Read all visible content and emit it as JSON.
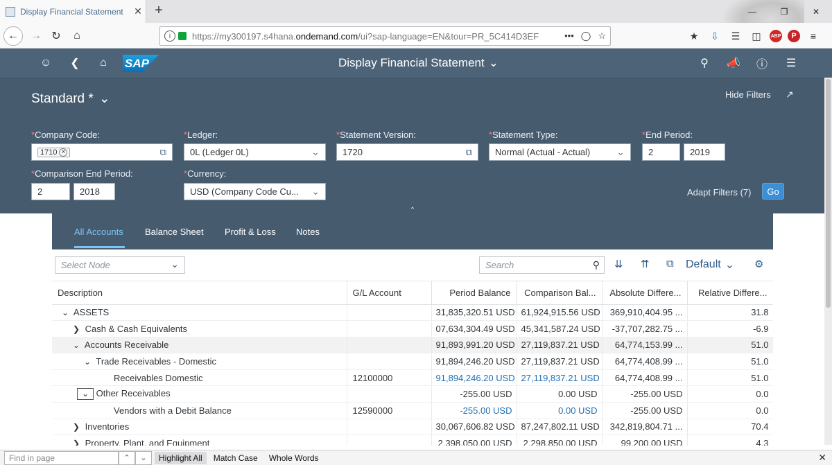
{
  "browser": {
    "tab_title": "Display Financial Statement",
    "tab_close": "✕",
    "new_tab": "+",
    "url_host": "my300197.s4hana.",
    "url_domain": "ondemand.com",
    "url_path": "/ui?sap-language=EN&tour=PR_5C414D3EF",
    "url_prefix": "https://",
    "url_more": "•••"
  },
  "shell": {
    "logo": "SAP",
    "title": "Display Financial Statement"
  },
  "filters": {
    "variant": "Standard *",
    "hide_filters": "Hide Filters",
    "adapt_filters": "Adapt Filters (7)",
    "go": "Go",
    "required_mark": "*",
    "company_code": {
      "label": "Company Code:",
      "token": "1710"
    },
    "ledger": {
      "label": "Ledger:",
      "value": "0L (Ledger 0L)"
    },
    "statement_version": {
      "label": "Statement Version:",
      "value": "1720"
    },
    "statement_type": {
      "label": "Statement Type:",
      "value": "Normal (Actual - Actual)"
    },
    "end_period": {
      "label": "End Period:",
      "period": "2",
      "year": "2019"
    },
    "comparison_end_period": {
      "label": "Comparison End Period:",
      "period": "2",
      "year": "2018"
    },
    "currency": {
      "label": "Currency:",
      "value": "USD (Company Code Cu..."
    }
  },
  "tabs": [
    "All Accounts",
    "Balance Sheet",
    "Profit & Loss",
    "Notes"
  ],
  "tools": {
    "select_node_placeholder": "Select Node",
    "search_placeholder": "Search",
    "layout": "Default"
  },
  "table": {
    "columns": [
      "Description",
      "G/L Account",
      "Period Balance",
      "Comparison Bal...",
      "Absolute Differe...",
      "Relative Differe..."
    ],
    "rows": [
      {
        "desc": "ASSETS",
        "gl": "",
        "period": "31,835,320.51 USD",
        "comparison": "61,924,915.56 USD",
        "absolute": "369,910,404.95 ...",
        "relative": "31.8"
      },
      {
        "desc": "Cash & Cash Equivalents",
        "gl": "",
        "period": "07,634,304.49 USD",
        "comparison": "45,341,587.24 USD",
        "absolute": "-37,707,282.75 ...",
        "relative": "-6.9"
      },
      {
        "desc": "Accounts Receivable",
        "gl": "",
        "period": "91,893,991.20 USD",
        "comparison": "27,119,837.21 USD",
        "absolute": "64,774,153.99 ...",
        "relative": "51.0"
      },
      {
        "desc": "Trade Receivables - Domestic",
        "gl": "",
        "period": "91,894,246.20 USD",
        "comparison": "27,119,837.21 USD",
        "absolute": "64,774,408.99 ...",
        "relative": "51.0"
      },
      {
        "desc": "Receivables Domestic",
        "gl": "12100000",
        "period": "91,894,246.20 USD",
        "comparison": "27,119,837.21 USD",
        "absolute": "64,774,408.99 ...",
        "relative": "51.0"
      },
      {
        "desc": "Other Receivables",
        "gl": "",
        "period": "-255.00 USD",
        "comparison": "0.00 USD",
        "absolute": "-255.00 USD",
        "relative": "0.0"
      },
      {
        "desc": "Vendors with a Debit Balance",
        "gl": "12590000",
        "period": "-255.00 USD",
        "comparison": "0.00 USD",
        "absolute": "-255.00 USD",
        "relative": "0.0"
      },
      {
        "desc": "Inventories",
        "gl": "",
        "period": "30,067,606.82 USD",
        "comparison": "87,247,802.11 USD",
        "absolute": "342,819,804.71 ...",
        "relative": "70.4"
      },
      {
        "desc": "Property, Plant, and Equipment",
        "gl": "",
        "period": "2,398,050.00 USD",
        "comparison": "2,298,850.00 USD",
        "absolute": "99,200.00 USD",
        "relative": "4.3"
      }
    ]
  },
  "findbar": {
    "placeholder": "Find in page",
    "highlight_all": "Highlight All",
    "match_case": "Match Case",
    "whole_words": "Whole Words"
  },
  "colors": {
    "shell": "#4d6478",
    "filterbar": "#475b6f",
    "accent": "#7cc3f7",
    "link": "#1f6fb5",
    "go_button": "#3c8fd5"
  }
}
